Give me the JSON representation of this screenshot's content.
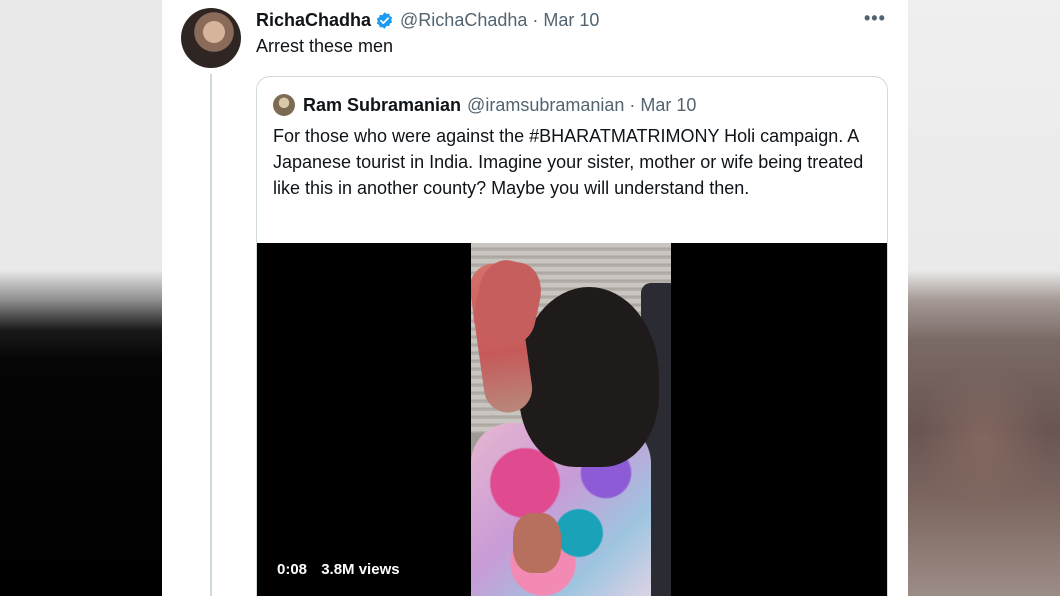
{
  "tweet": {
    "author_name": "RichaChadha",
    "author_handle": "@RichaChadha",
    "date": "· Mar 10",
    "more_label": "•••",
    "text": "Arrest these men"
  },
  "quoted": {
    "author_name": "Ram Subramanian",
    "author_handle": "@iramsubramanian",
    "date": "· Mar 10",
    "text": "For those who were against the #BHARATMATRIMONY Holi campaign.  A Japanese tourist in India. Imagine your sister, mother or wife being treated like this in another county? Maybe you will understand then.",
    "video": {
      "time": "0:08",
      "views": "3.8M views"
    }
  },
  "colors": {
    "verified": "#1d9bf0",
    "secondary_text": "#536471",
    "primary_text": "#0f1419",
    "border": "#cfd9de"
  }
}
